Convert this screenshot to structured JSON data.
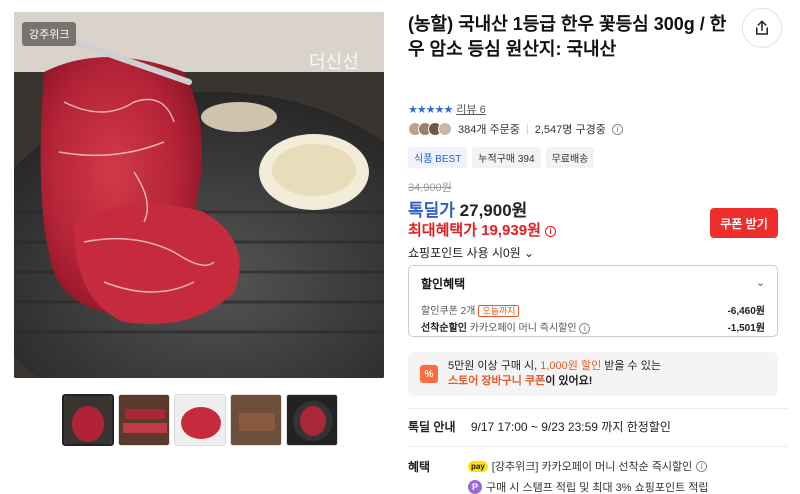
{
  "gallery": {
    "seller_badge": "강주위크",
    "watermark": "더신선",
    "thumbnail_count": 5
  },
  "product": {
    "title": "(농할) 국내산 1등급 한우 꽃등심 300g / 한우 암소 등심 원산지: 국내산",
    "share_icon": "share-icon",
    "rating_stars": "★★★★★",
    "review_label": "리뷰 6",
    "orders": "384개 주문중",
    "subscribers": "2,547명 구경중",
    "chips": [
      "식품 BEST",
      "누적구매 394",
      "무료배송"
    ],
    "original_price": "34,900원",
    "deal_label": "톡딜가",
    "deal_price": "27,900원",
    "max_label": "최대혜택가",
    "max_price": "19,939원",
    "coupon_button": "쿠폰 받기",
    "point_use": "쇼핑포인트 사용 시0원",
    "discount": {
      "heading": "할인혜택",
      "line1_label": "할인쿠폰 2개",
      "line1_tag": "오늘까지",
      "line1_value": "-6,460원",
      "line2_bold": "선착순할인",
      "line2_label": "카카오페이 머니 즉시할인",
      "line2_value": "-1,501원"
    },
    "banner": {
      "icon": "%",
      "text1a": "5만원 이상 구매 시,",
      "text1b": "1,000원 할인",
      "text1c": "받을 수 있는",
      "text2a": "스토어 장바구니 쿠폰",
      "text2b": "이 있어요!"
    },
    "deal_info": {
      "label": "톡딜 안내",
      "value": "9/17 17:00 ~ 9/23 23:59 까지 한정할인"
    },
    "benefits": {
      "label": "혜택",
      "line1": "[강추위크] 카카오페이 머니 선착순 즉시할인",
      "line1_badge": "pay",
      "line2": "구매 시 스탬프 적립 및 최대 3% 쇼핑포인트 적립",
      "line2_badge": "P"
    }
  },
  "colors": {
    "accent_blue": "#2f5fc8",
    "sale_red": "#e02020",
    "coupon_red": "#ef2d2d",
    "orange": "#e45a2a"
  }
}
